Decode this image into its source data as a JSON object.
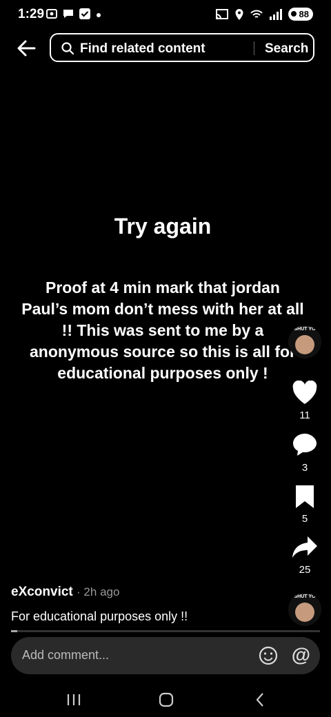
{
  "status": {
    "time": "1:29",
    "battery": "88",
    "left_icons": [
      "screenshot-icon",
      "chat-icon",
      "check-icon",
      "dot-icon"
    ],
    "right_icons": [
      "cast-icon",
      "location-icon",
      "wifi-icon",
      "signal-icon",
      "battery-icon"
    ]
  },
  "search": {
    "placeholder": "Find related content",
    "button_label": "Search"
  },
  "content": {
    "title": "Try again",
    "description": "Proof at 4 min mark that jordan Paul’s mom don’t mess with her at all !! This was sent to me by a anonymous source so this is all for educational purposes only !"
  },
  "actions": {
    "avatar_tag": "SHUT YO",
    "likes": "11",
    "comments": "3",
    "bookmarks": "5",
    "shares": "25"
  },
  "post": {
    "username": "eXconvict",
    "timestamp": "· 2h ago",
    "caption": "For educational purposes only !!",
    "progress": 0.02
  },
  "comment_bar": {
    "placeholder": "Add comment..."
  },
  "nav": {
    "items": [
      "recents-icon",
      "home-icon",
      "back-icon"
    ]
  }
}
